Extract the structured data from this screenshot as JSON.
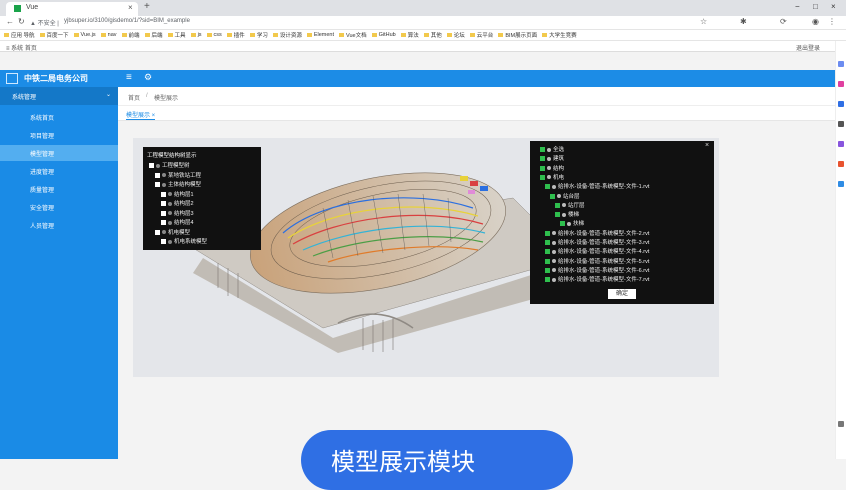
{
  "browser": {
    "tab_title": "Vue",
    "tab_close": "×",
    "new_tab": "+",
    "url_security": "▲ 不安全 |",
    "url": "yjbsuper.io/3100/gisdemo/1/?sid=BIM_example",
    "window_controls": [
      "−",
      "□",
      "×"
    ],
    "bookmarks": [
      "应用 导航",
      "百度一下",
      "Vue.js",
      "nav",
      "前端",
      "后端",
      "工具",
      "js",
      "css",
      "插件",
      "学习",
      "设计资源",
      "Element",
      "Vue文档",
      "GitHub",
      "算法",
      "其他",
      "论坛",
      "云平台",
      "BIM展示页面",
      "大学生竞赛"
    ],
    "app_bar_label": "≡ 系统 首页",
    "app_bar_right": "退出登录"
  },
  "header": {
    "company": "中铁二局电务公司",
    "menu_icon": "≡",
    "gear_icon": "⚙"
  },
  "sidebar": {
    "head": "系统管理",
    "items": [
      {
        "label": "系统首页",
        "active": false
      },
      {
        "label": "项目管理",
        "active": false
      },
      {
        "label": "模型管理",
        "active": true
      },
      {
        "label": "进度管理",
        "active": false
      },
      {
        "label": "质量管理",
        "active": false
      },
      {
        "label": "安全管理",
        "active": false
      },
      {
        "label": "人员管理",
        "active": false
      }
    ]
  },
  "breadcrumb": {
    "home": "首页",
    "sep": "/",
    "current": "模型展示"
  },
  "content_tab": {
    "label": "模型展示 ×"
  },
  "left_panel": {
    "title": "工程模型结构树显示",
    "rows": [
      "工程模型树",
      "某地铁站工程",
      "主体结构模型",
      "结构层1",
      "结构层2",
      "结构层3",
      "结构层4",
      "机电模型",
      "机电系统模型"
    ]
  },
  "right_panel": {
    "close": "×",
    "rows": [
      "全选",
      "建筑",
      "结构",
      "机电",
      "给排水-设备-管道-系统模型-文件-1.rvt",
      "站台层",
      "站厅层",
      "楼梯",
      "扶梯",
      "给排水-设备-管道-系统模型-文件-2.rvt",
      "给排水-设备-管道-系统模型-文件-3.rvt",
      "给排水-设备-管道-系统模型-文件-4.rvt",
      "给排水-设备-管道-系统模型-文件-5.rvt",
      "给排水-设备-管道-系统模型-文件-6.rvt",
      "给排水-设备-管道-系统模型-文件-7.rvt"
    ],
    "button": "确定"
  },
  "bottom_pill": {
    "text": "模型展示模块"
  },
  "colors": {
    "primary": "#1c8ce6",
    "sidebar": "#1a8be6",
    "pill": "#2f6fe4"
  }
}
